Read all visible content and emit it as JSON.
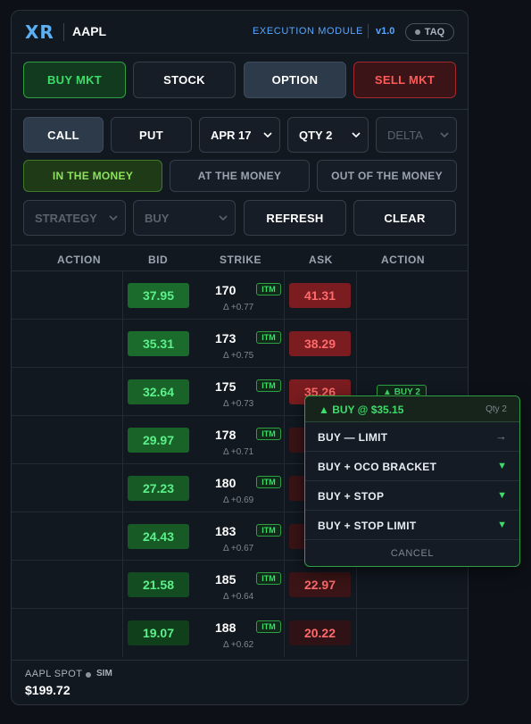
{
  "header": {
    "logo": "XR",
    "ticker": "AAPL",
    "module": "EXECUTION MODULE",
    "version": "v1.0",
    "feed": "TAQ"
  },
  "order_type_buttons": {
    "buy_mkt": "BUY MKT",
    "stock": "STOCK",
    "option": "OPTION",
    "sell_mkt": "SELL MKT"
  },
  "option_controls": {
    "call": "CALL",
    "put": "PUT",
    "expiry": "APR 17",
    "qty": "QTY 2",
    "delta_placeholder": "DELTA"
  },
  "moneyness": {
    "itm": "IN THE MONEY",
    "atm": "AT THE MONEY",
    "otm": "OUT OF THE MONEY"
  },
  "filters": {
    "strategy": "STRATEGY",
    "side": "BUY",
    "refresh": "REFRESH",
    "clear": "CLEAR"
  },
  "table": {
    "headers": [
      "ACTION",
      "BID",
      "STRIKE",
      "ASK",
      "ACTION"
    ],
    "rows": [
      {
        "bid": "37.95",
        "strike": "170",
        "badge": "ITM",
        "delta": "Δ +0.77",
        "ask": "41.31"
      },
      {
        "bid": "35.31",
        "strike": "173",
        "badge": "ITM",
        "delta": "Δ +0.75",
        "ask": "38.29"
      },
      {
        "bid": "32.64",
        "strike": "175",
        "badge": "ITM",
        "delta": "Δ +0.73",
        "ask": "35.26",
        "action": "▲ BUY 2"
      },
      {
        "bid": "29.97",
        "strike": "178",
        "badge": "ITM",
        "delta": "Δ +0.71",
        "ask": ""
      },
      {
        "bid": "27.23",
        "strike": "180",
        "badge": "ITM",
        "delta": "Δ +0.69",
        "ask": ""
      },
      {
        "bid": "24.43",
        "strike": "183",
        "badge": "ITM",
        "delta": "Δ +0.67",
        "ask": ""
      },
      {
        "bid": "21.58",
        "strike": "185",
        "badge": "ITM",
        "delta": "Δ +0.64",
        "ask": "22.97"
      },
      {
        "bid": "19.07",
        "strike": "188",
        "badge": "ITM",
        "delta": "Δ +0.62",
        "ask": "20.22"
      }
    ]
  },
  "footer": {
    "spot_label": "AAPL SPOT",
    "mode": "SIM",
    "spot_value": "$199.72"
  },
  "popup": {
    "title": "▲ BUY @ $35.15",
    "qty": "Qty 2",
    "items": [
      {
        "label": "BUY — LIMIT",
        "marker": "→"
      },
      {
        "label": "BUY + OCO BRACKET",
        "marker": "▼"
      },
      {
        "label": "BUY + STOP",
        "marker": "▼"
      },
      {
        "label": "BUY + STOP LIMIT",
        "marker": "▼"
      }
    ],
    "cancel": "CANCEL"
  },
  "colors": {
    "accent_blue": "#58a6ff",
    "buy_green": "#3fdc6a",
    "sell_red": "#ff5a57",
    "background": "#0d1117"
  }
}
